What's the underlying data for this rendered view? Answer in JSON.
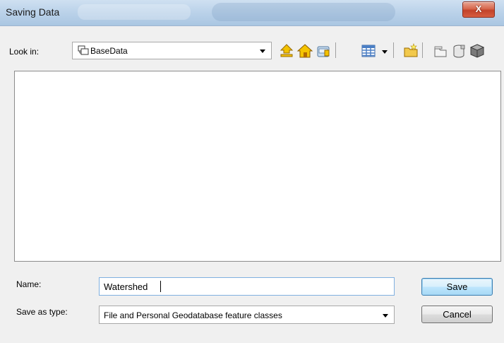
{
  "window": {
    "title": "Saving Data",
    "close_label": "X"
  },
  "lookin": {
    "label": "Look in:",
    "value": "BaseData"
  },
  "toolbar": {
    "icons": [
      "up-one-level-icon",
      "home-icon",
      "connect-folder-icon",
      "view-details-icon",
      "view-menu-chevron-icon",
      "new-folder-icon",
      "new-file-geodatabase-icon",
      "new-personal-geodatabase-icon",
      "catalog-options-icon"
    ]
  },
  "form": {
    "name_label": "Name:",
    "name_value": "Watershed",
    "type_label": "Save as type:",
    "type_value": "File and Personal Geodatabase feature classes"
  },
  "buttons": {
    "save": "Save",
    "cancel": "Cancel"
  },
  "colors": {
    "titlebar": "#bcd3ea",
    "close": "#c2432a",
    "folder": "#e6b400",
    "save_button_border": "#3c7fb1"
  }
}
